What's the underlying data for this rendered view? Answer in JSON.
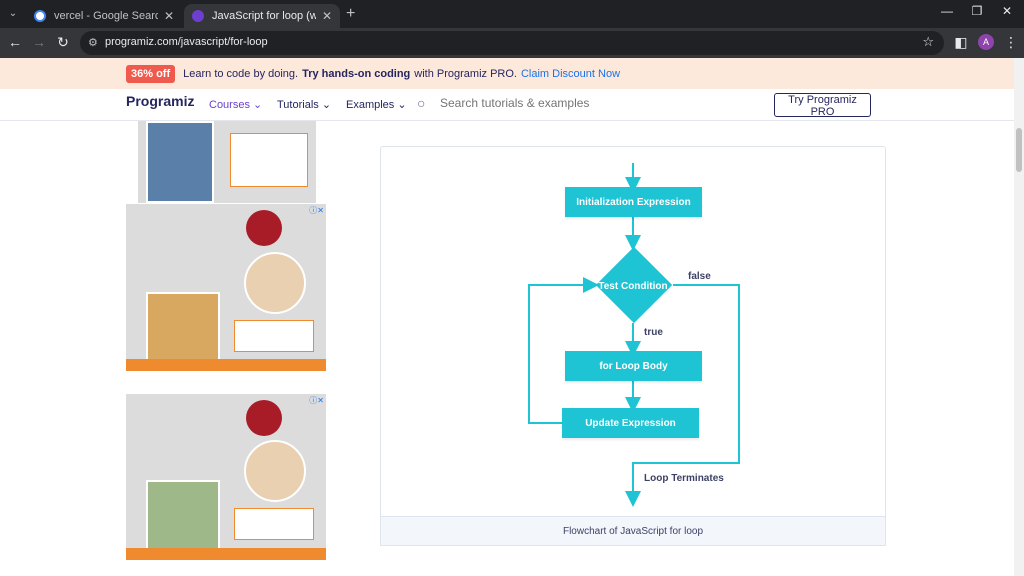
{
  "browser": {
    "tabs": [
      {
        "title": "vercel - Google Search",
        "active": false,
        "icon": "google-icon"
      },
      {
        "title": "JavaScript for loop (with Examp",
        "active": true,
        "icon": "programiz-icon"
      }
    ],
    "url": "programiz.com/javascript/for-loop",
    "profile_initial": "A"
  },
  "promo": {
    "badge": "36% off",
    "text_before": "Learn to code by doing.",
    "bold": "Try hands-on coding",
    "text_after": "with Programiz PRO.",
    "link": "Claim Discount Now"
  },
  "header": {
    "logo": "Programiz",
    "menu": [
      "Courses",
      "Tutorials",
      "Examples"
    ],
    "search_placeholder": "Search tutorials & examples",
    "cta": "Try Programiz PRO"
  },
  "flowchart": {
    "init": "Initialization Expression",
    "test": "Test Condition",
    "body": "for Loop Body",
    "update": "Update Expression",
    "label_false": "false",
    "label_true": "true",
    "terminate": "Loop Terminates",
    "caption": "Flowchart of JavaScript for loop",
    "accent": "#1ec3d4"
  }
}
